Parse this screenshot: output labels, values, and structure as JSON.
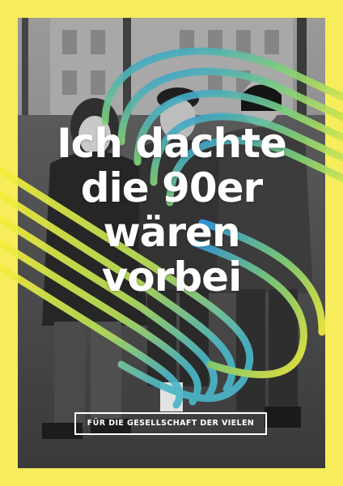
{
  "poster": {
    "headline_lines": [
      "Ich dachte",
      "die 90er",
      "wären",
      "vorbei"
    ],
    "slogan": "FÜR DIE GESELLSCHAFT DER VIELEN"
  },
  "colors": {
    "frame": "#f7ec5a",
    "text": "#ffffff",
    "stripe_blue": "#2f9be0",
    "stripe_green": "#7fd07a",
    "stripe_yellow": "#f4ee3c"
  },
  "icons": [
    "gradient-stripes-graphic"
  ]
}
